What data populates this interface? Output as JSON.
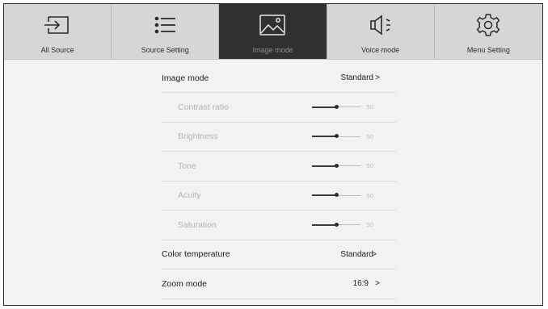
{
  "tabs": [
    {
      "label": "All Source",
      "icon": "input-source-icon",
      "active": false
    },
    {
      "label": "Source Setting",
      "icon": "list-icon",
      "active": false
    },
    {
      "label": "Image mode",
      "icon": "image-icon",
      "active": true
    },
    {
      "label": "Voice mode",
      "icon": "speaker-icon",
      "active": false
    },
    {
      "label": "Menu Setting",
      "icon": "gear-icon",
      "active": false
    }
  ],
  "image_mode": {
    "label": "Image mode",
    "value": "Standard",
    "chevron": ">"
  },
  "sliders": [
    {
      "label": "Contrast ratio",
      "value": 50
    },
    {
      "label": "Brightness",
      "value": 50
    },
    {
      "label": "Tone",
      "value": 50
    },
    {
      "label": "Acuity",
      "value": 50
    },
    {
      "label": "Saturation",
      "value": 50
    }
  ],
  "color_temperature": {
    "label": "Color temperature",
    "value": "Standard",
    "chevron": ">"
  },
  "zoom_mode": {
    "label": "Zoom mode",
    "value": "16:9",
    "chevron": ">"
  },
  "colors": {
    "active_tab": "#303030",
    "tab_bar": "#d6d6d6",
    "background": "#f2f2f2"
  }
}
